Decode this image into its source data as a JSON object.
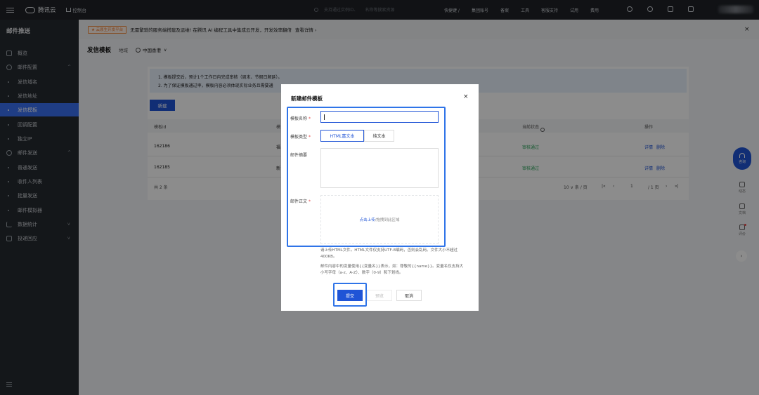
{
  "topbar": {
    "brand": "腾讯云",
    "console": "控制台",
    "search_placeholder_1": "支持通过实例ID、",
    "search_placeholder_2": "名称等搜索资源",
    "links": [
      "快捷键 /",
      "集团账号",
      "备案",
      "工具",
      "客服支持",
      "试用",
      "费用"
    ]
  },
  "sidebar": {
    "title": "邮件推送",
    "items": [
      {
        "label": "概览",
        "kind": "top"
      },
      {
        "label": "邮件配置",
        "kind": "group",
        "chevron": "^"
      },
      {
        "label": "发信域名",
        "kind": "sub"
      },
      {
        "label": "发信地址",
        "kind": "sub"
      },
      {
        "label": "发信模板",
        "kind": "sub",
        "active": true
      },
      {
        "label": "回调配置",
        "kind": "sub"
      },
      {
        "label": "独立IP",
        "kind": "sub"
      },
      {
        "label": "邮件发送",
        "kind": "group",
        "chevron": "^"
      },
      {
        "label": "普通发送",
        "kind": "sub"
      },
      {
        "label": "收件人列表",
        "kind": "sub"
      },
      {
        "label": "批量发送",
        "kind": "sub"
      },
      {
        "label": "邮件模拟器",
        "kind": "sub"
      },
      {
        "label": "数据统计",
        "kind": "group",
        "chevron": "v"
      },
      {
        "label": "投递回应",
        "kind": "group",
        "chevron": "v"
      }
    ]
  },
  "notice": {
    "tag": "★ 云原生开发平台",
    "text": "无需繁琐的服务端搭建及运维! 在腾讯 AI 编程工具中集成云开发，开发效率翻倍",
    "link": "查看详情 ›"
  },
  "page": {
    "title": "发信模板",
    "region_label": "地域",
    "region_value": "中国香港"
  },
  "tips": {
    "line1": "1. 模板提交后，预计1个工作日内完成审核（周末、节假日顺延）。",
    "line2": "2. 为了保证模板通过率，模板内容必须体现实际业务且需要通"
  },
  "table": {
    "new_button": "新建",
    "headers": {
      "id": "模板id",
      "name": "模",
      "status": "当前状态",
      "actions": "操作"
    },
    "rows": [
      {
        "id": "162186",
        "name": "福",
        "status": "审核通过",
        "detail": "详情",
        "delete": "删除"
      },
      {
        "id": "162185",
        "name": "新",
        "status": "审核通过",
        "detail": "详情",
        "delete": "删除"
      }
    ],
    "total": "共 2 条",
    "page_size": "10 ∨ 条 / 页",
    "page_first": "|«",
    "page_prev": "‹",
    "page_num": "1",
    "page_of": "/ 1 页",
    "page_next": "›",
    "page_last": "»|"
  },
  "right_tools": {
    "fab": "咨询",
    "items": [
      "动态",
      "文档",
      "评价"
    ]
  },
  "modal": {
    "title": "新建邮件模板",
    "close": "×",
    "name_label": "模板名称",
    "type_label": "模板类型",
    "type_options": [
      "HTML富文本",
      "纯文本"
    ],
    "summary_label": "邮件摘要",
    "body_label": "邮件正文",
    "upload_link": "点击上传",
    "upload_rest": "/拖拽到此区域",
    "hint1": "请上传HTML文件。HTML文件仅支持UTF-8编码，否则会乱码。文件大小不超过400KB。",
    "hint2": "邮件内容中的变量使用{{变量名}}表示，如：尊敬的{{name}}。变量名仅支持大小写字母（a-z、A-Z）、数字（0-9）和下划线。",
    "submit": "提交",
    "preview": "预览",
    "cancel": "取消"
  }
}
